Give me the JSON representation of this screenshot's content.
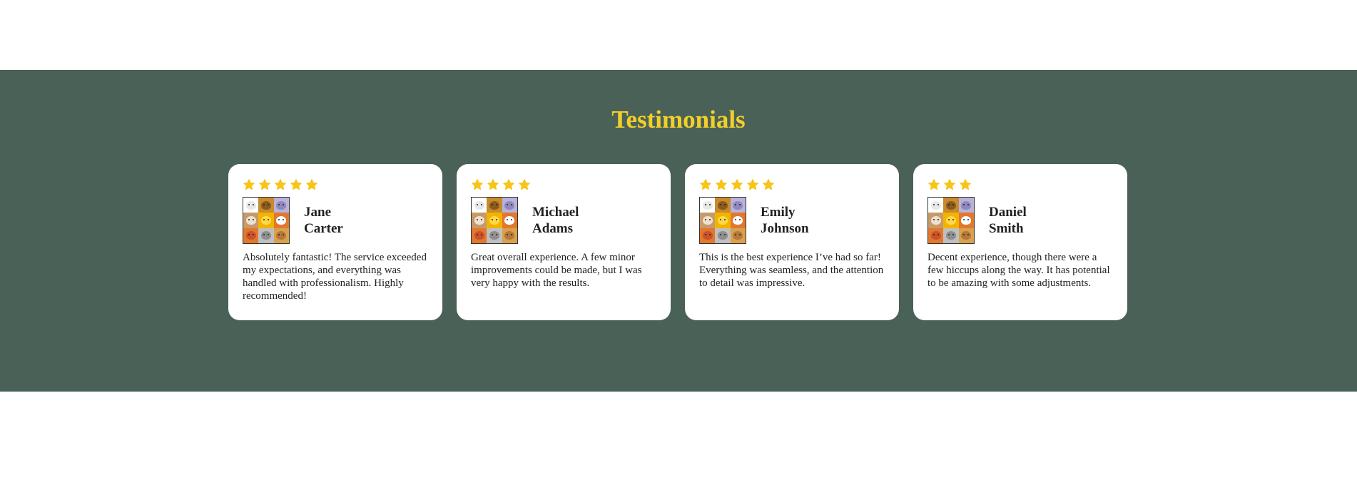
{
  "section": {
    "title": "Testimonials",
    "background": "#4a6158",
    "title_color": "#f2cf2a",
    "star_color": "#f5c518"
  },
  "testimonials": [
    {
      "rating": 5,
      "first_name": "Jane",
      "last_name": "Carter",
      "avatar_icon": "animal-faces-grid-icon",
      "text": "Absolutely fantastic! The service exceeded my expectations, and everything was handled with professionalism. Highly recommended!"
    },
    {
      "rating": 4,
      "first_name": "Michael",
      "last_name": "Adams",
      "avatar_icon": "animal-faces-grid-icon",
      "text": "Great overall experience. A few minor improvements could be made, but I was very happy with the results."
    },
    {
      "rating": 5,
      "first_name": "Emily",
      "last_name": "Johnson",
      "avatar_icon": "animal-faces-grid-icon",
      "text": "This is the best experience I’ve had so far! Everything was seamless, and the attention to detail was impressive."
    },
    {
      "rating": 3,
      "first_name": "Daniel",
      "last_name": "Smith",
      "avatar_icon": "animal-faces-grid-icon",
      "text": "Decent experience, though there were a few hiccups along the way. It has potential to be amazing with some adjustments."
    }
  ]
}
